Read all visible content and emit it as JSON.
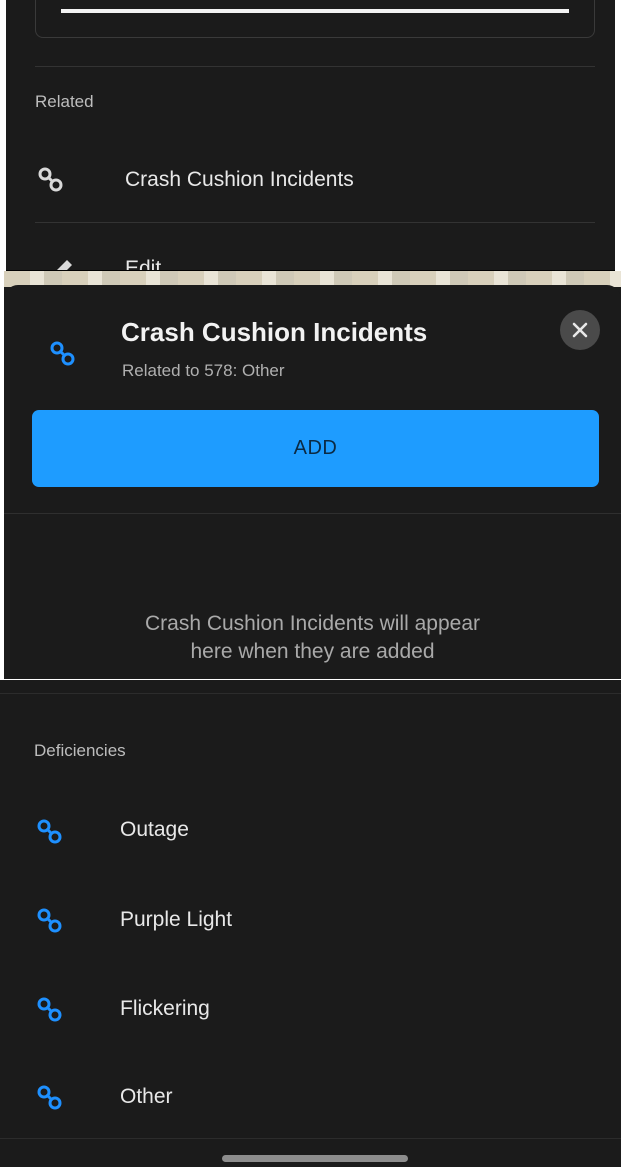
{
  "colors": {
    "background": "#1b1b1b",
    "accent": "#1e9cff",
    "link_icon_gray": "#d9d9d9",
    "link_icon_blue": "#1e90ff"
  },
  "panel1": {
    "section_label": "Related",
    "items": [
      {
        "label": "Crash Cushion Incidents",
        "icon": "link-icon"
      },
      {
        "label": "Edit",
        "icon": "pencil-icon"
      }
    ]
  },
  "panel2": {
    "title": "Crash Cushion Incidents",
    "subtitle": "Related to 578: Other",
    "title_icon": "link-icon",
    "close_icon": "close-icon",
    "add_label": "ADD",
    "empty_line1": "Crash Cushion Incidents will appear",
    "empty_line2": "here when they are added"
  },
  "panel3": {
    "section_label": "Deficiencies",
    "items": [
      {
        "label": "Outage",
        "icon": "link-icon"
      },
      {
        "label": "Purple Light",
        "icon": "link-icon"
      },
      {
        "label": "Flickering",
        "icon": "link-icon"
      },
      {
        "label": "Other",
        "icon": "link-icon"
      }
    ]
  }
}
